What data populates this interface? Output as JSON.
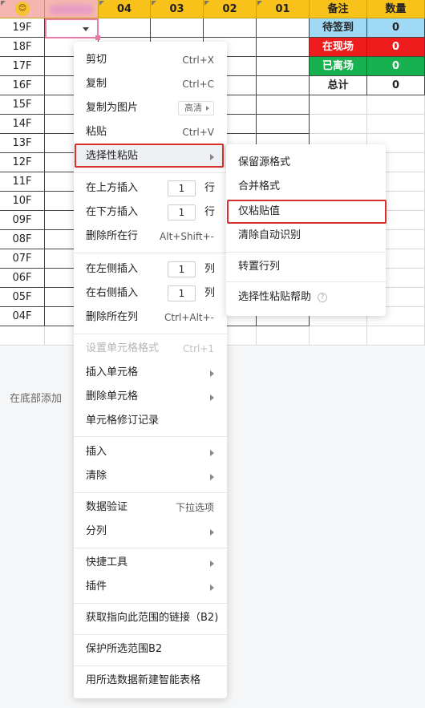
{
  "header": {
    "first_emoji": "😊",
    "columns": [
      "04",
      "03",
      "02",
      "01"
    ],
    "note_label": "备注",
    "count_label": "数量"
  },
  "floors": [
    "19F",
    "18F",
    "17F",
    "16F",
    "15F",
    "14F",
    "13F",
    "12F",
    "11F",
    "10F",
    "09F",
    "08F",
    "07F",
    "06F",
    "05F",
    "04F"
  ],
  "stats": [
    {
      "label": "待签到",
      "value": "0",
      "bg": "#9fd9f5",
      "color": "#222222"
    },
    {
      "label": "在现场",
      "value": "0",
      "bg": "#ee1c1c",
      "color": "#ffffff"
    },
    {
      "label": "已离场",
      "value": "0",
      "bg": "#17b24f",
      "color": "#ffffff"
    },
    {
      "label": "总计",
      "value": "0",
      "bg": "#ffffff",
      "color": "#222222"
    }
  ],
  "add_bottom_label": "在底部添加",
  "context_menu": {
    "cut": {
      "label": "剪切",
      "shortcut": "Ctrl+X"
    },
    "copy": {
      "label": "复制",
      "shortcut": "Ctrl+C"
    },
    "copy_as_image": {
      "label": "复制为图片",
      "tag": "高清"
    },
    "paste": {
      "label": "粘贴",
      "shortcut": "Ctrl+V"
    },
    "paste_special": {
      "label": "选择性粘贴"
    },
    "insert_above": {
      "label": "在上方插入",
      "count": "1",
      "unit": "行"
    },
    "insert_below": {
      "label": "在下方插入",
      "count": "1",
      "unit": "行"
    },
    "delete_row": {
      "label": "删除所在行",
      "shortcut": "Alt+Shift+-"
    },
    "insert_left": {
      "label": "在左侧插入",
      "count": "1",
      "unit": "列"
    },
    "insert_right": {
      "label": "在右侧插入",
      "count": "1",
      "unit": "列"
    },
    "delete_col": {
      "label": "删除所在列",
      "shortcut": "Ctrl+Alt+-"
    },
    "format_cells": {
      "label": "设置单元格格式",
      "shortcut": "Ctrl+1"
    },
    "insert_cells": {
      "label": "插入单元格"
    },
    "delete_cells": {
      "label": "删除单元格"
    },
    "cell_history": {
      "label": "单元格修订记录"
    },
    "insert": {
      "label": "插入"
    },
    "clear": {
      "label": "清除"
    },
    "data_validation": {
      "label": "数据验证",
      "shortcut": "下拉选项"
    },
    "split_column": {
      "label": "分列"
    },
    "quick_tools": {
      "label": "快捷工具"
    },
    "plugins": {
      "label": "插件"
    },
    "get_link": {
      "label": "获取指向此范围的链接（B2)"
    },
    "protect_range": {
      "label": "保护所选范围B2"
    },
    "new_smart_table": {
      "label": "用所选数据新建智能表格"
    }
  },
  "paste_submenu": {
    "keep_source": "保留源格式",
    "merge_format": "合并格式",
    "values_only": "仅粘贴值",
    "clear_auto": "清除自动识别",
    "transpose": "转置行列",
    "help": "选择性粘贴帮助",
    "help_icon": "?"
  }
}
